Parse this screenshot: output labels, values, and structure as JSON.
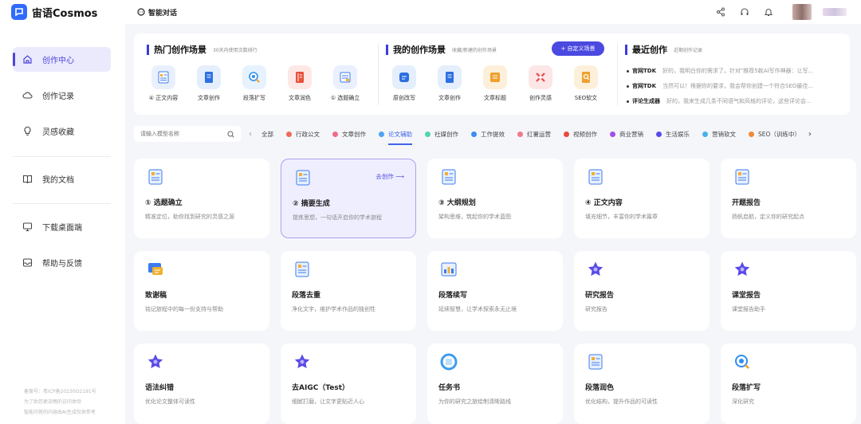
{
  "app": {
    "name": "宙语Cosmos",
    "chat_label": "智能对话"
  },
  "colors": {
    "accent": "#4b49e0",
    "active_tab": "#3d66e8",
    "sidebar_active_bg": "#ebeafd"
  },
  "sidebar": {
    "items": [
      {
        "label": "创作中心",
        "icon": "home-icon"
      },
      {
        "label": "创作记录",
        "icon": "cloud-icon"
      },
      {
        "label": "灵感收藏",
        "icon": "bulb-icon"
      },
      {
        "label": "我的文档",
        "icon": "book-icon"
      },
      {
        "label": "下载桌面端",
        "icon": "monitor-icon"
      },
      {
        "label": "帮助与反馈",
        "icon": "inbox-icon"
      }
    ],
    "footer": [
      "备案号：粤ICP备20230O2191号",
      "为了助您更流畅的访问体验",
      "智能问答的内容由AI生成仅供参考"
    ]
  },
  "hot": {
    "title": "热门创作场景",
    "subtitle": "30天内使用次数排行",
    "items": [
      "④ 正文内容",
      "文章创作",
      "段落扩写",
      "文章润色",
      "① 选题确立"
    ]
  },
  "mine": {
    "title": "我的创作场景",
    "subtitle": "收藏/新建的创作场景",
    "custom_button": "+ 自定义场景",
    "items": [
      "原创改写",
      "文章创作",
      "文章标题",
      "创作灵感",
      "SEO软文"
    ]
  },
  "recent": {
    "title": "最近创作",
    "subtitle": "近期创作记录",
    "rows": [
      {
        "name": "官网TDK",
        "text": "好的，我明白你的需求了。针对\"推荐5款AI写作神器：让写..."
      },
      {
        "name": "官网TDK",
        "text": "当然可以！根据你的要求，我会帮你创建一个符合SEO最佳..."
      },
      {
        "name": "评论生成器",
        "text": "好的，我来生成几条不同语气和风格的评论，这些评论会..."
      }
    ]
  },
  "search": {
    "placeholder": "请输入模型名称"
  },
  "tabs": [
    {
      "label": "全部",
      "color": ""
    },
    {
      "label": "行政公文",
      "color": "#f06a5a"
    },
    {
      "label": "文章创作",
      "color": "#f06a8a"
    },
    {
      "label": "论文辅助",
      "color": "#4fa3f0"
    },
    {
      "label": "社媒创作",
      "color": "#52d6a8"
    },
    {
      "label": "工作提效",
      "color": "#3d8cf5"
    },
    {
      "label": "红薯运营",
      "color": "#f07a8a"
    },
    {
      "label": "视频创作",
      "color": "#e84a3a"
    },
    {
      "label": "商业营销",
      "color": "#a050e8"
    },
    {
      "label": "生活娱乐",
      "color": "#5a4ae8"
    },
    {
      "label": "营销软文",
      "color": "#4ab0e8"
    },
    {
      "label": "SEO（训练中）",
      "color": "#f08a3a"
    }
  ],
  "cards": [
    {
      "title": "① 选题确立",
      "desc": "精准定位，助你找到研究的灵感之源",
      "icon": "doc-icon"
    },
    {
      "title": "② 摘要生成",
      "desc": "提炼思想，一句话开启你的学术旅程",
      "icon": "doc-icon",
      "action": "去创作 ⟶"
    },
    {
      "title": "③ 大纲规划",
      "desc": "架构思维，筑起你的学术蓝图",
      "icon": "doc-icon"
    },
    {
      "title": "④ 正文内容",
      "desc": "填充细节，丰富你的学术篇章",
      "icon": "doc-icon"
    },
    {
      "title": "开题报告",
      "desc": "扬帆启航，定义你的研究起点",
      "icon": "doc-icon"
    },
    {
      "title": "致谢稿",
      "desc": "铭记旅程中的每一份支持与帮助",
      "icon": "chat-icon"
    },
    {
      "title": "段落去重",
      "desc": "净化文字，维护学术作品的独创性",
      "icon": "doc-icon"
    },
    {
      "title": "段落续写",
      "desc": "延续智慧，让学术探索永无止境",
      "icon": "chart-icon"
    },
    {
      "title": "研究报告",
      "desc": "研究报告",
      "icon": "star-icon"
    },
    {
      "title": "课堂报告",
      "desc": "课堂报告助手",
      "icon": "star-icon"
    },
    {
      "title": "语法纠错",
      "desc": "优化论文整体可读性",
      "icon": "star-icon"
    },
    {
      "title": "去AIGC（Test）",
      "desc": "细腻打磨，让文字更贴近人心",
      "icon": "star-icon"
    },
    {
      "title": "任务书",
      "desc": "为你的研究之旅绘制清晰路线",
      "icon": "ring-icon"
    },
    {
      "title": "段落润色",
      "desc": "优化结构，提升作品的可读性",
      "icon": "doc-icon"
    },
    {
      "title": "段落扩写",
      "desc": "深化研究",
      "icon": "search-doc-icon"
    }
  ]
}
